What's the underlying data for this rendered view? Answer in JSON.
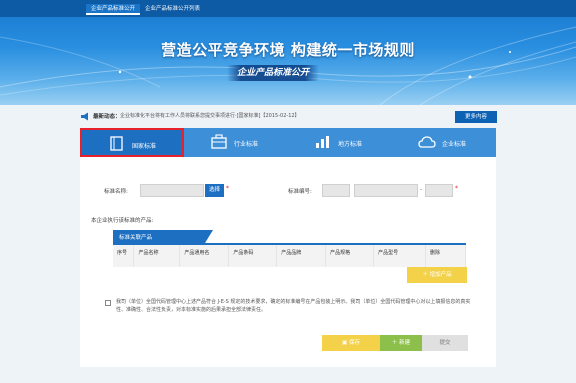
{
  "topnav": {
    "items": [
      "企业产品标准公开",
      "企业产品标准公开列表"
    ]
  },
  "banner": {
    "slogan": "营造公平竞争环境 构建统一市场规则",
    "subtitle": "企业产品标准公开"
  },
  "notice": {
    "label": "最新动态：",
    "text": "企业标准化平台将有工作人员将联系您提交事项进行·[国家标准]【2015-02-12】",
    "more_label": "更多内容"
  },
  "tabs": [
    "国家标准",
    "行业标准",
    "地方标准",
    "企业标准"
  ],
  "form": {
    "standard_name_label": "标准名称:",
    "select_label": "选择",
    "standard_no_label": "标准编号:",
    "sep1": "-",
    "sep2": "-",
    "required_mark": "*",
    "products_heading": "本企业执行该标准的产品:",
    "table_title": "标准关联产品",
    "columns": [
      "序号",
      "产品名称",
      "产品通用名",
      "产品条码",
      "产品品牌",
      "产品规格",
      "产品型号",
      "删除"
    ],
    "add_product_label": "增加产品",
    "declaration": "我司（单位）全国代码管理中心上述产品符合 J-E-S 规定的技术要求，确定的标准编号在产品包装上明示。我司（单位）全国代码管理中心对以上填报信息的真实性、准确性、合法性负责，对本标准实施的后果承担全部法律责任。",
    "save_label": "保存",
    "new_label": "新建",
    "submit_label": "提交"
  },
  "colors": {
    "primary": "#1d6fc2",
    "nav": "#0d5aa5",
    "yellow": "#f3d24a",
    "green": "#8cc04b",
    "red": "#e62129"
  }
}
